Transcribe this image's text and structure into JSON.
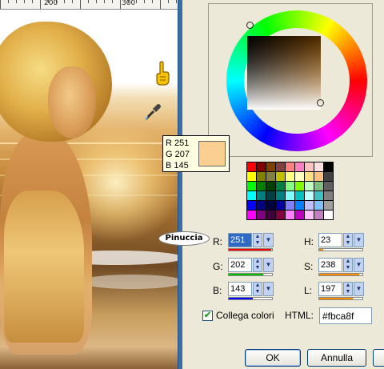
{
  "ruler": {
    "labels": [
      "200",
      "300"
    ]
  },
  "watermark": {
    "text": "Pinuccia"
  },
  "tooltip": {
    "r": "R 251",
    "g": "G 207",
    "b": "B 145",
    "swatch_color": "#fbcf91"
  },
  "palette": [
    [
      "#ff0000",
      "#800000",
      "#804000",
      "#804040",
      "#ff8080",
      "#ff80c0",
      "#ffc0c0",
      "#ffe0e0",
      "#000000"
    ],
    [
      "#ffff00",
      "#808000",
      "#808040",
      "#c0c000",
      "#ffff80",
      "#ffffc0",
      "#ffe080",
      "#ffc080",
      "#404040"
    ],
    [
      "#00ff00",
      "#008000",
      "#004000",
      "#008040",
      "#80ff80",
      "#80ff00",
      "#c0ffc0",
      "#80c080",
      "#606060"
    ],
    [
      "#00ffff",
      "#008080",
      "#004040",
      "#008080",
      "#80ffff",
      "#00c0c0",
      "#c0ffff",
      "#40c0c0",
      "#808080"
    ],
    [
      "#0000ff",
      "#000080",
      "#000040",
      "#0000a0",
      "#8080ff",
      "#0080ff",
      "#c0c0ff",
      "#80c0ff",
      "#a0a0a0"
    ],
    [
      "#ff00ff",
      "#800080",
      "#400040",
      "#800040",
      "#ff80ff",
      "#c000c0",
      "#ffc0ff",
      "#c080c0",
      "#ffffff"
    ]
  ],
  "fields": {
    "r": {
      "label": "R:",
      "value": "251",
      "level": 0.984,
      "color": "#ff0000"
    },
    "g": {
      "label": "G:",
      "value": "202",
      "level": 0.792,
      "color": "#00c000"
    },
    "b": {
      "label": "B:",
      "value": "143",
      "level": 0.561,
      "color": "#0000ff"
    },
    "h": {
      "label": "H:",
      "value": "23",
      "level": 0.09,
      "color": "#ff8c00"
    },
    "s": {
      "label": "S:",
      "value": "238",
      "level": 0.933,
      "color": "#ff8c00"
    },
    "l": {
      "label": "L:",
      "value": "197",
      "level": 0.773,
      "color": "#ff8c00"
    }
  },
  "link_colors": {
    "label": "Collega colori",
    "checked": true
  },
  "html": {
    "label": "HTML:",
    "value": "#fbca8f"
  },
  "buttons": {
    "ok": "OK",
    "cancel": "Annulla"
  }
}
